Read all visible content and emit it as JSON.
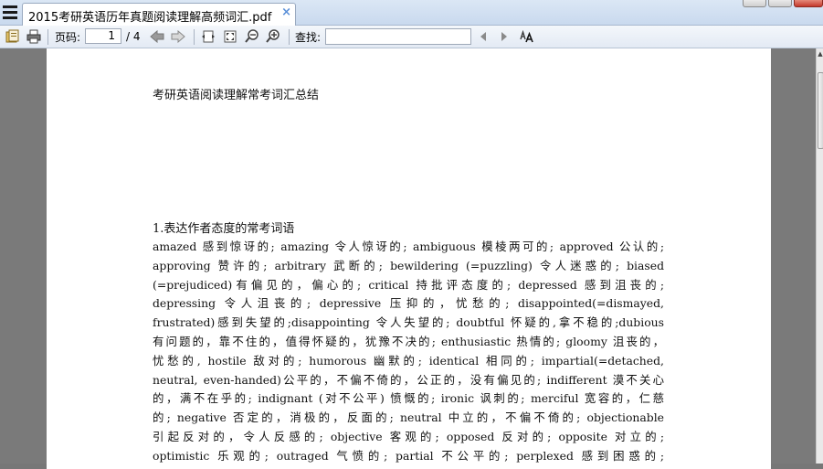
{
  "tab": {
    "title": "2015考研英语历年真题阅读理解高频词汇.pdf",
    "close": "×"
  },
  "toolbar": {
    "page_label": "页码:",
    "page_value": "1",
    "page_total": "/ 4",
    "find_label": "查找:",
    "find_value": ""
  },
  "document": {
    "title": "考研英语阅读理解常考词汇总结",
    "section_heading": "1.表达作者态度的常考词语",
    "lines": [
      "amazed 感到惊讶的; amazing 令人惊讶的; ambiguous 模棱两可的; approved 公认的;",
      "approving 赞许的; arbitrary 武断的; bewildering (=puzzling) 令人迷惑的; biased",
      "(=prejudiced)有偏见的，偏心的; critical 持批评态度的; depressed 感到沮丧的;",
      "depressing 令人沮丧的; depressive 压抑的，忧愁的; disappointed(=dismayed,",
      "frustrated)感到失望的;disappointing 令人失望的; doubtful 怀疑的,拿不稳的;dubious",
      "有问题的，靠不住的，值得怀疑的，犹豫不决的; enthusiastic 热情的; gloomy 沮丧的，",
      "忧愁的, hostile 敌对的; humorous 幽默的; identical 相同的; impartial(=detached,",
      "neutral, even-handed)公平的，不偏不倚的，公正的，没有偏见的; indifferent 漠不关心",
      "的，满不在乎的; indignant (对不公平) 愤慨的; ironic 讽刺的; merciful 宽容的，仁慈",
      "的; negative 否定的，消极的，反面的; neutral 中立的，不偏不倚的; objectionable",
      "引起反对的，令人反感的; objective 客观的; opposed 反对的; opposite 对立的;",
      "optimistic 乐观的; outraged 气愤的; partial 不公平的; perplexed 感到困惑的;"
    ]
  },
  "icons": {
    "menu": "menu-icon",
    "open": "open-file-icon",
    "print": "print-icon",
    "prev": "previous-page-icon",
    "next": "next-page-icon",
    "fit_width": "fit-width-icon",
    "fit_page": "fit-page-icon",
    "zoom_out": "zoom-out-icon",
    "zoom_in": "zoom-in-icon",
    "find_prev": "find-previous-icon",
    "find_next": "find-next-icon",
    "match_case": "match-case-icon"
  }
}
